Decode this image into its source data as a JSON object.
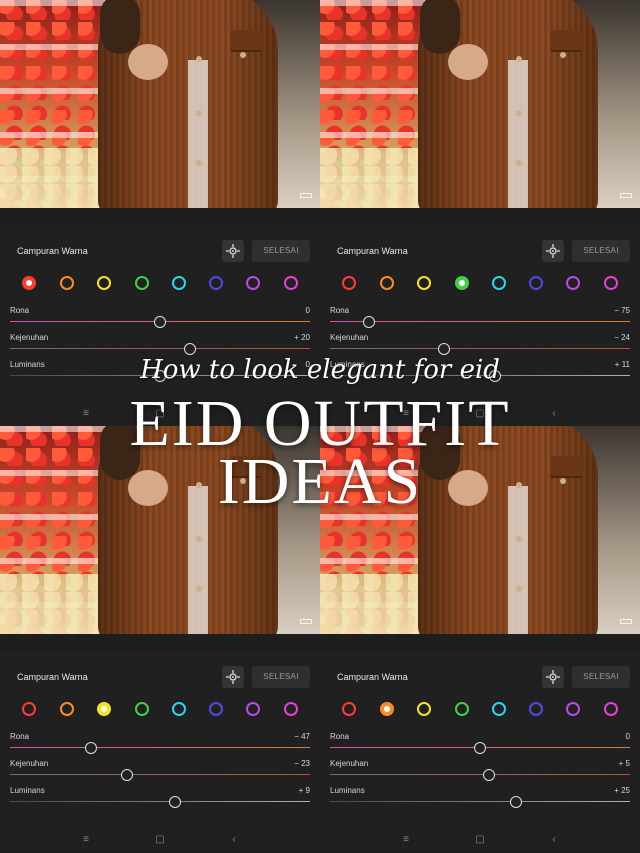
{
  "overlay": {
    "subtitle": "How to look elegant for eid",
    "title_line1": "EID OUTFIT",
    "title_line2": "IDEAS"
  },
  "colors": {
    "red": "#ff3b30",
    "orange": "#ff8a2a",
    "yellow": "#f5e425",
    "green": "#3fd14a",
    "aqua": "#2bd4e6",
    "blue": "#4a4fe0",
    "purple": "#b44ee8",
    "magenta": "#e83fd8"
  },
  "panels": [
    {
      "title": "Campuran Warna",
      "done_label": "SELESAI",
      "selected_color": "red",
      "rows": [
        {
          "label": "Rona",
          "value": "0",
          "level": 0.5
        },
        {
          "label": "Kejenuhan",
          "value": "+ 20",
          "level": 0.6
        },
        {
          "label": "Luminans",
          "value": "0",
          "level": 0.5
        }
      ]
    },
    {
      "title": "Campuran Warna",
      "done_label": "SELESAI",
      "selected_color": "green",
      "rows": [
        {
          "label": "Rona",
          "value": "− 75",
          "level": 0.13
        },
        {
          "label": "Kejenuhan",
          "value": "− 24",
          "level": 0.38
        },
        {
          "label": "Luminans",
          "value": "+ 11",
          "level": 0.55
        }
      ]
    },
    {
      "title": "Campuran Warna",
      "done_label": "SELESAI",
      "selected_color": "yellow",
      "rows": [
        {
          "label": "Rona",
          "value": "− 47",
          "level": 0.27
        },
        {
          "label": "Kejenuhan",
          "value": "− 23",
          "level": 0.39
        },
        {
          "label": "Luminans",
          "value": "+ 9",
          "level": 0.55
        }
      ]
    },
    {
      "title": "Campuran Warna",
      "done_label": "SELESAI",
      "selected_color": "orange",
      "rows": [
        {
          "label": "Rona",
          "value": "0",
          "level": 0.5
        },
        {
          "label": "Kejenuhan",
          "value": "+ 5",
          "level": 0.53
        },
        {
          "label": "Luminans",
          "value": "+ 25",
          "level": 0.62
        }
      ]
    }
  ],
  "nav_icons": [
    "menu-icon",
    "home-icon",
    "back-icon"
  ]
}
